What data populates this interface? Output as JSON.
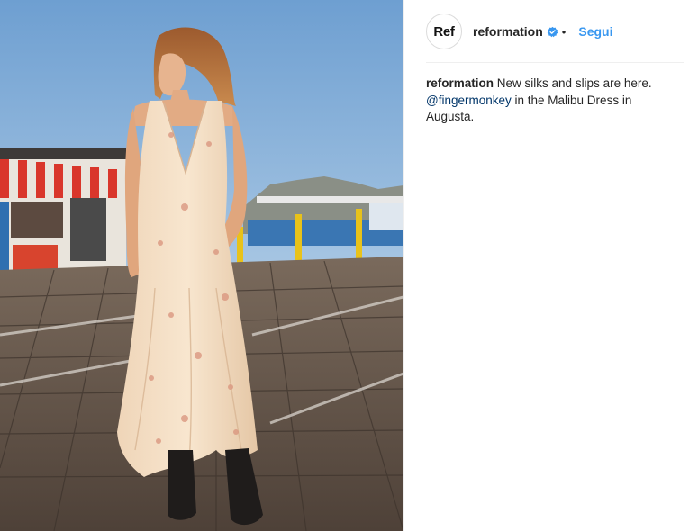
{
  "header": {
    "avatar_text": "Ref",
    "username": "reformation",
    "separator": "•",
    "follow_label": "Segui",
    "verified_color": "#3897f0"
  },
  "caption": {
    "username": "reformation",
    "text_1": "New silks and slips are here.",
    "mention": "@fingermonkey",
    "text_2": "in the Malibu Dress in Augusta."
  },
  "colors": {
    "link": "#3897f0",
    "mention": "#003569",
    "text": "#262626"
  }
}
